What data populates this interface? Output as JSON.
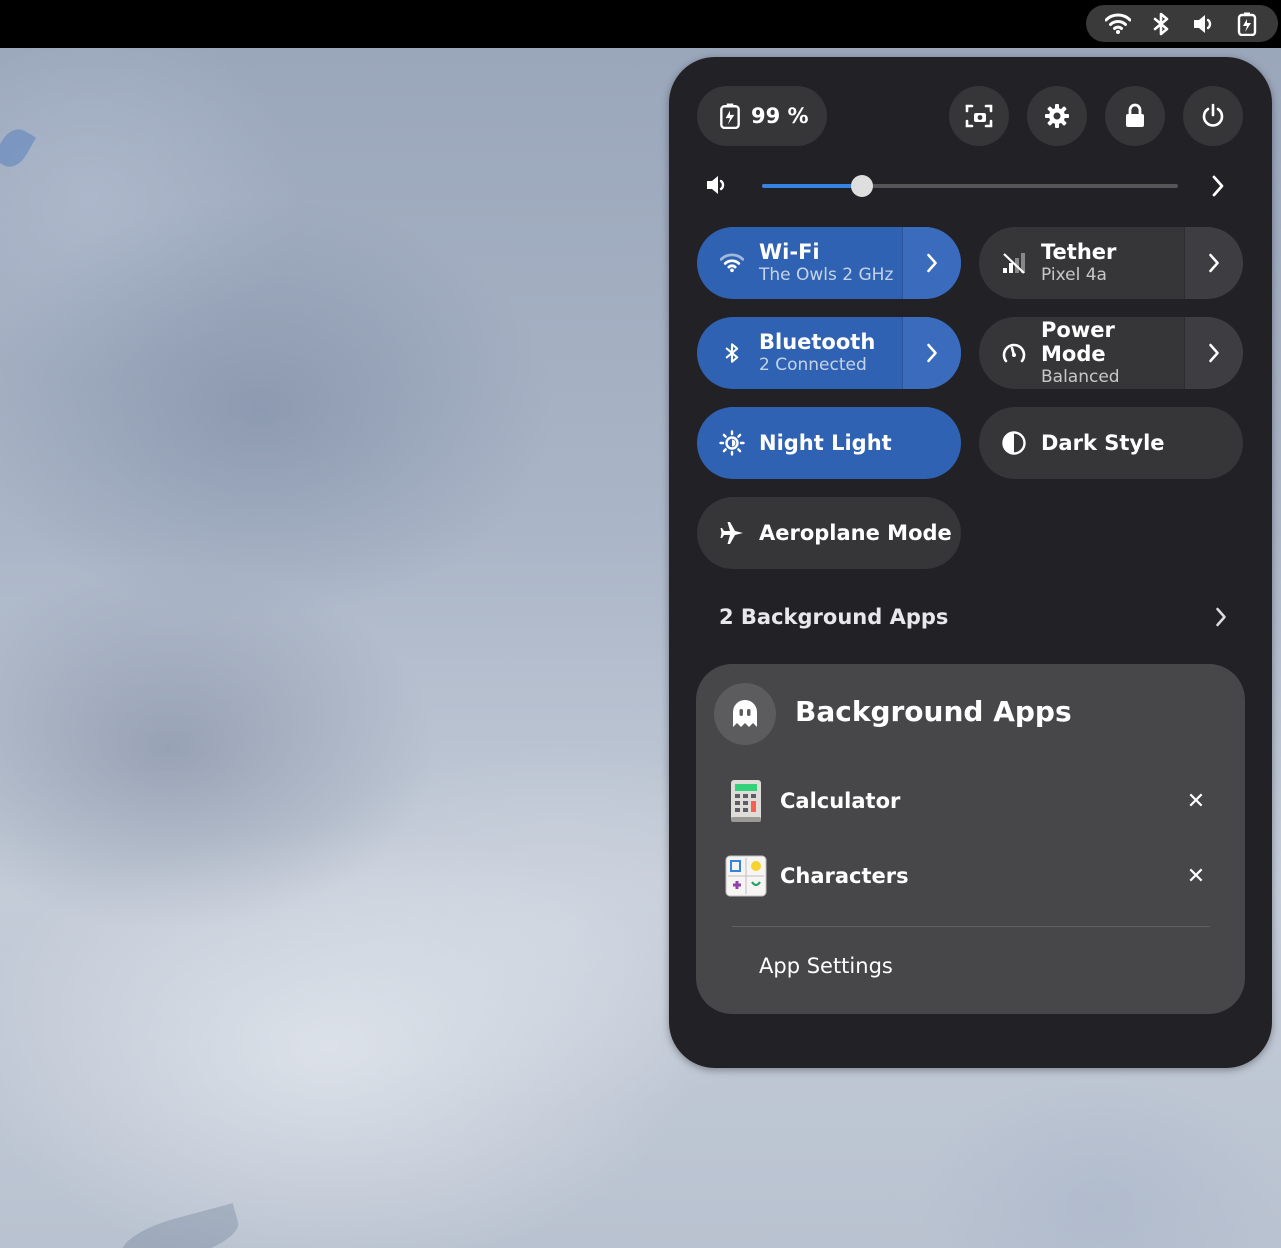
{
  "topbar": {
    "indicators": [
      "wifi-icon",
      "bluetooth-icon",
      "volume-icon",
      "battery-icon"
    ]
  },
  "quick_settings": {
    "battery_label": "99 %",
    "buttons": [
      "screenshot-icon",
      "settings-icon",
      "lock-icon",
      "power-icon"
    ],
    "volume_level_percent": 24,
    "toggles": {
      "wifi": {
        "title": "Wi-Fi",
        "subtitle": "The Owls 2 GHz",
        "active": true
      },
      "tether": {
        "title": "Tether",
        "subtitle": "Pixel 4a",
        "active": false
      },
      "bluetooth": {
        "title": "Bluetooth",
        "subtitle": "2 Connected",
        "active": true
      },
      "power_mode": {
        "title": "Power Mode",
        "subtitle": "Balanced",
        "active": false
      },
      "night_light": {
        "title": "Night Light",
        "active": true
      },
      "dark_style": {
        "title": "Dark Style",
        "active": false
      },
      "aeroplane": {
        "title": "Aeroplane Mode",
        "active": false
      }
    },
    "background_apps_row": "2 Background Apps"
  },
  "background_apps_menu": {
    "title": "Background Apps",
    "apps": [
      {
        "name": "Calculator"
      },
      {
        "name": "Characters"
      }
    ],
    "close_glyph": "✕",
    "app_settings_label": "App Settings"
  },
  "colors": {
    "accent": "#3062b3",
    "panel": "#222226",
    "pill": "#363639",
    "submenu": "#474749"
  }
}
